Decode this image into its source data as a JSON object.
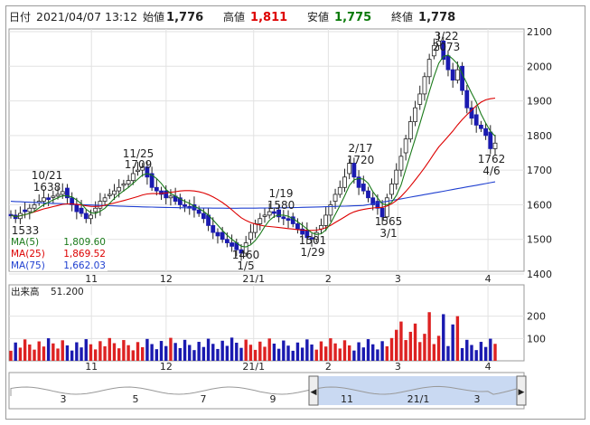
{
  "header": {
    "date_label": "日付",
    "datetime": "2021/04/07 13:12",
    "open_label": "始値",
    "open": "1,776",
    "high_label": "高値",
    "high": "1,811",
    "low_label": "安値",
    "low": "1,775",
    "close_label": "終値",
    "close": "1,778"
  },
  "legend": {
    "ma5_label": "MA(5)",
    "ma5_value": "1,809.60",
    "ma25_label": "MA(25)",
    "ma25_value": "1,869.52",
    "ma75_label": "MA(75)",
    "ma75_value": "1,662.03"
  },
  "volume_panel": {
    "label": "出来高",
    "value": "51.200",
    "y_ticks": [
      "200",
      "100"
    ]
  },
  "price_axis_ticks": [
    "2100",
    "2000",
    "1900",
    "1800",
    "1700",
    "1600",
    "1500",
    "1400"
  ],
  "x_ticks": [
    "11",
    "12",
    "21/1",
    "2",
    "3",
    "4"
  ],
  "navigator": {
    "ticks": [
      "3",
      "5",
      "7",
      "9",
      "11",
      "21/1",
      "3"
    ],
    "left_handle": "◀",
    "right_handle": "▶"
  },
  "colors": {
    "up": "#d22",
    "down": "#1a1ab0",
    "ma5": "#1a7a1a",
    "ma25": "#d00",
    "ma75": "#2040d0"
  },
  "annotations": [
    {
      "text": "10/21",
      "sub": "1638"
    },
    {
      "text": "11/25",
      "sub": "1709"
    },
    {
      "text": "1/19",
      "sub": "1580"
    },
    {
      "text": "2/17",
      "sub": "1720"
    },
    {
      "text": "3/22",
      "sub": "2073"
    },
    {
      "text": "1533",
      "sub": ""
    },
    {
      "text": "1460",
      "sub": "1/5"
    },
    {
      "text": "1501",
      "sub": "1/29"
    },
    {
      "text": "1565",
      "sub": "3/1"
    },
    {
      "text": "1762",
      "sub": "4/6"
    }
  ],
  "chart_data": {
    "type": "candlestick",
    "ylim": [
      1400,
      2100
    ],
    "x_labels": [
      "11",
      "12",
      "21/1",
      "2",
      "3",
      "4"
    ],
    "closes": [
      1570,
      1560,
      1575,
      1580,
      1590,
      1600,
      1610,
      1620,
      1615,
      1625,
      1630,
      1638,
      1620,
      1600,
      1580,
      1575,
      1560,
      1570,
      1590,
      1610,
      1620,
      1630,
      1640,
      1650,
      1660,
      1670,
      1690,
      1700,
      1709,
      1680,
      1650,
      1640,
      1630,
      1620,
      1625,
      1610,
      1600,
      1595,
      1590,
      1585,
      1575,
      1560,
      1540,
      1520,
      1510,
      1500,
      1490,
      1480,
      1470,
      1460,
      1490,
      1520,
      1545,
      1560,
      1570,
      1580,
      1575,
      1565,
      1560,
      1555,
      1545,
      1530,
      1515,
      1505,
      1501,
      1520,
      1540,
      1570,
      1600,
      1630,
      1650,
      1680,
      1720,
      1680,
      1650,
      1640,
      1620,
      1600,
      1590,
      1565,
      1620,
      1660,
      1700,
      1740,
      1790,
      1840,
      1880,
      1920,
      1970,
      2020,
      2060,
      2073,
      2020,
      1990,
      1960,
      1990,
      1930,
      1880,
      1850,
      1830,
      1820,
      1800,
      1762,
      1778
    ],
    "ma5_last": 1809.6,
    "ma25_last": 1869.52,
    "ma75_last": 1662.03,
    "volume_ylim": [
      0,
      300
    ],
    "volume_last": 51.2
  }
}
